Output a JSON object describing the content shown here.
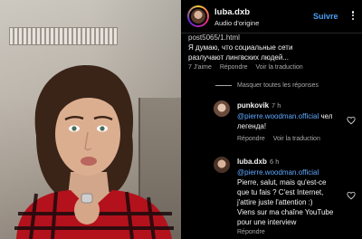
{
  "video": {},
  "header": {
    "username": "luba.dxb",
    "audio": "Audio d'origine",
    "follow_label": "Suivre"
  },
  "comment": {
    "text_line1": "post5065/1.html",
    "text_line2": "Я думаю, что социальные сети",
    "text_line3": "разлучают лингвских людей...",
    "likes": "7 J'aime",
    "reply_label": "Répondre",
    "translate_label": "Voir la traduction"
  },
  "hide_replies": "Masquer toutes les réponses",
  "replies": [
    {
      "username": "punkovik",
      "time": "7 h",
      "mention": "@pierre.woodman.official",
      "text": " чел легенда!",
      "reply_label": "Répondre",
      "translate_label": "Voir la traduction"
    },
    {
      "username": "luba.dxb",
      "time": "6 h",
      "mention": "@pierre.woodman.official",
      "text_lines": [
        "Pierre, salut, mais qu'est-ce",
        "que tu fais ? C'est Internet,",
        "j'attire juste l'attention :)",
        "Viens sur ma chaîne YouTube",
        "pour une interview"
      ],
      "reply_label": "Répondre"
    }
  ]
}
